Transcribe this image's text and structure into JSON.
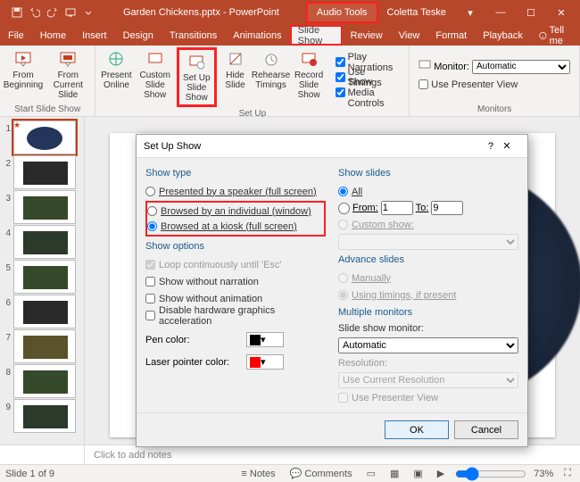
{
  "title": {
    "doc": "Garden Chickens.pptx - PowerPoint",
    "audio_tools": "Audio Tools",
    "user": "Coletta Teske"
  },
  "menu": {
    "file": "File",
    "home": "Home",
    "insert": "Insert",
    "design": "Design",
    "transitions": "Transitions",
    "animations": "Animations",
    "slideshow": "Slide Show",
    "review": "Review",
    "view": "View",
    "format": "Format",
    "playback": "Playback",
    "tell": "Tell me"
  },
  "ribbon": {
    "from_beginning": "From\nBeginning",
    "from_current": "From\nCurrent Slide",
    "present_online": "Present\nOnline",
    "custom": "Custom Slide\nShow",
    "setup": "Set Up\nSlide Show",
    "hide": "Hide\nSlide",
    "rehearse": "Rehearse\nTimings",
    "record": "Record Slide\nShow",
    "grp_start": "Start Slide Show",
    "grp_setup": "Set Up",
    "grp_mon": "Monitors",
    "play_narr": "Play Narrations",
    "use_tim": "Use Timings",
    "show_media": "Show Media Controls",
    "mon_lbl": "Monitor:",
    "mon_val": "Automatic",
    "use_presenter": "Use Presenter View"
  },
  "thumbs": {
    "count": 9
  },
  "notes": {
    "placeholder": "Click to add notes"
  },
  "status": {
    "slide": "Slide 1 of 9",
    "lang": "",
    "notes": "Notes",
    "comments": "Comments",
    "zoom": "73%"
  },
  "dialog": {
    "title": "Set Up Show",
    "show_type": "Show type",
    "opt_speaker": "Presented by a speaker (full screen)",
    "opt_window": "Browsed by an individual (window)",
    "opt_kiosk": "Browsed at a kiosk (full screen)",
    "show_options": "Show options",
    "loop": "Loop continuously until 'Esc'",
    "no_narr": "Show without narration",
    "no_anim": "Show without animation",
    "hw_accel": "Disable hardware graphics acceleration",
    "pen": "Pen color:",
    "laser": "Laser pointer color:",
    "show_slides": "Show slides",
    "all": "All",
    "from": "From:",
    "to": "To:",
    "from_v": "1",
    "to_v": "9",
    "custom": "Custom show:",
    "advance": "Advance slides",
    "manual": "Manually",
    "timings": "Using timings, if present",
    "multi": "Multiple monitors",
    "slide_mon": "Slide show monitor:",
    "slide_mon_v": "Automatic",
    "res": "Resolution:",
    "res_v": "Use Current Resolution",
    "use_pres": "Use Presenter View",
    "ok": "OK",
    "cancel": "Cancel"
  }
}
